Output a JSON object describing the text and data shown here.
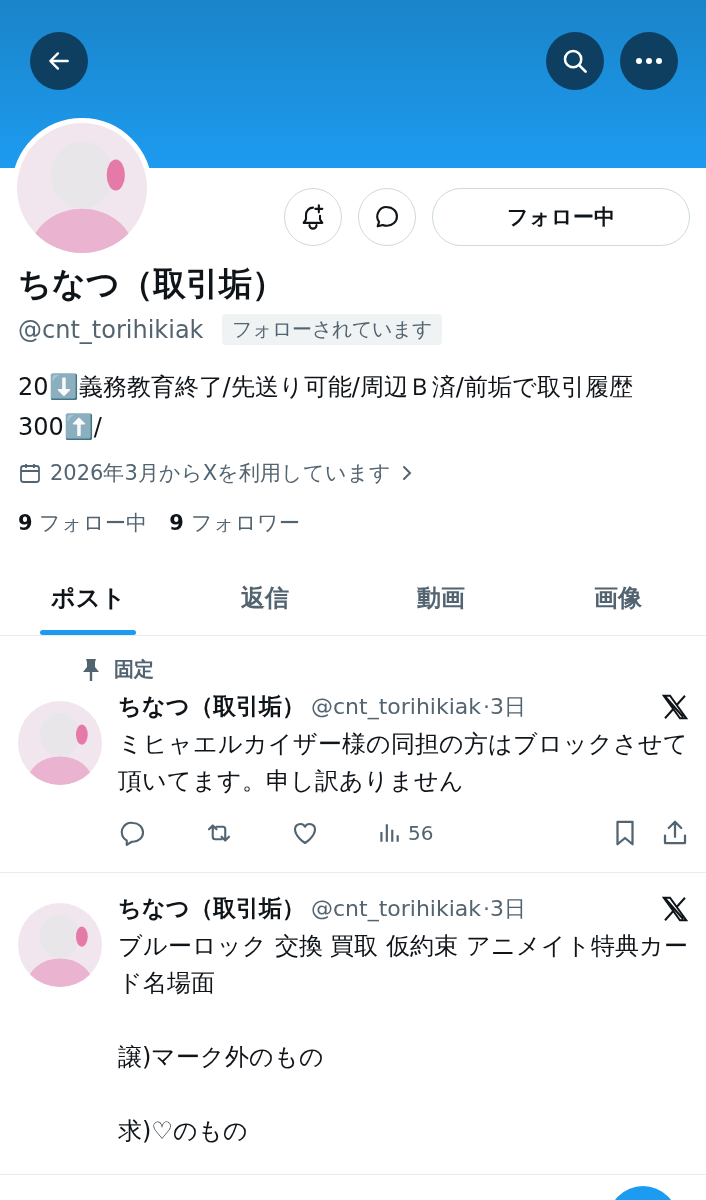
{
  "profile": {
    "name": "ちなつ（取引垢）",
    "handle": "@cnt_torihikiak",
    "follows_you_badge": "フォローされています",
    "follow_button": "フォロー中",
    "bio": "20⬇️義務教育終了/先送り可能/周辺Ｂ済/前垢で取引履歴300⬆️/",
    "joined": "2026年3月からXを利用しています",
    "following_count": "9",
    "following_label": "フォロー中",
    "followers_count": "9",
    "followers_label": "フォロワー"
  },
  "tabs": [
    {
      "label": "ポスト",
      "selected": true
    },
    {
      "label": "返信",
      "selected": false
    },
    {
      "label": "動画",
      "selected": false
    },
    {
      "label": "画像",
      "selected": false
    }
  ],
  "posts": [
    {
      "pinned": true,
      "pinned_label": "固定",
      "name": "ちなつ（取引垢）",
      "handle": "@cnt_torihikiak",
      "time": "·3日",
      "paragraphs": [
        "ミヒャエルカイザー様の同担の方はブロックさせて頂いてます。申し訳ありません"
      ],
      "views": "56"
    },
    {
      "pinned": false,
      "name": "ちなつ（取引垢）",
      "handle": "@cnt_torihikiak",
      "time": "·3日",
      "paragraphs": [
        "ブルーロック 交換 買取 仮約束 アニメイト特典カード名場面",
        "譲)マーク外のもの",
        "求)♡のもの"
      ]
    }
  ]
}
